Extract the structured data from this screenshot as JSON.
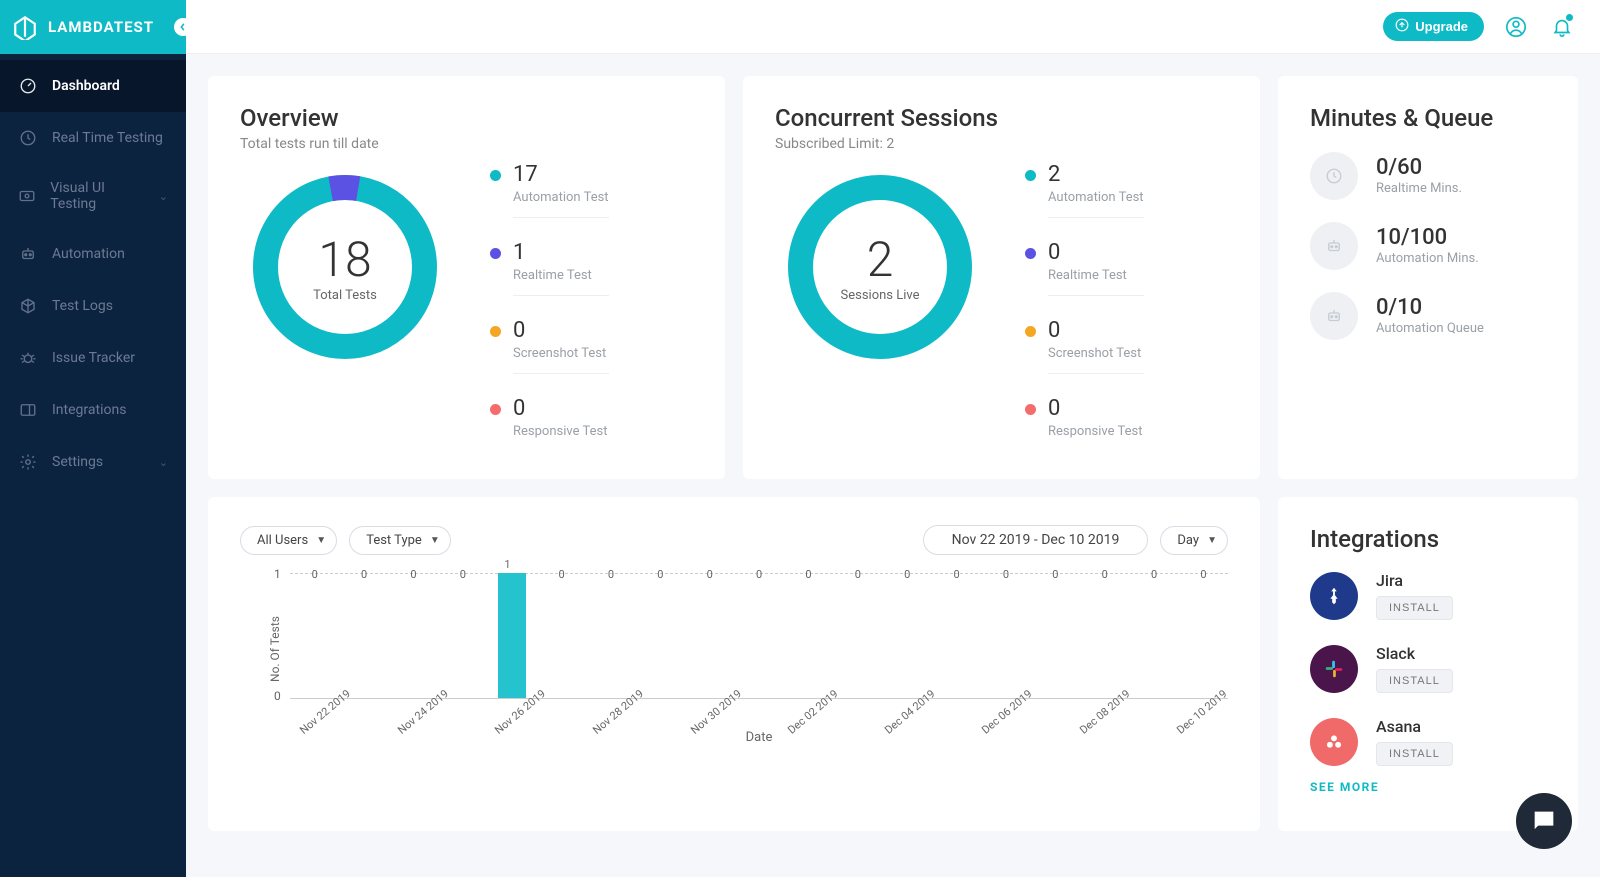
{
  "brand": {
    "name": "LAMBDATEST"
  },
  "topbar": {
    "upgrade_label": "Upgrade"
  },
  "sidebar": {
    "items": [
      {
        "label": "Dashboard",
        "active": true,
        "icon": "gauge-icon"
      },
      {
        "label": "Real Time Testing",
        "active": false,
        "icon": "clock-icon"
      },
      {
        "label": "Visual UI Testing",
        "active": false,
        "expandable": true,
        "icon": "eye-icon"
      },
      {
        "label": "Automation",
        "active": false,
        "icon": "robot-icon"
      },
      {
        "label": "Test Logs",
        "active": false,
        "icon": "cube-icon"
      },
      {
        "label": "Issue Tracker",
        "active": false,
        "icon": "bug-icon"
      },
      {
        "label": "Integrations",
        "active": false,
        "icon": "panel-icon"
      },
      {
        "label": "Settings",
        "active": false,
        "expandable": true,
        "icon": "gear-icon"
      }
    ]
  },
  "overview": {
    "title": "Overview",
    "subtitle": "Total tests run till date",
    "total": "18",
    "total_label": "Total Tests",
    "legend": [
      {
        "value": "17",
        "label": "Automation Test",
        "color": "#0ebac5"
      },
      {
        "value": "1",
        "label": "Realtime Test",
        "color": "#5b52e3"
      },
      {
        "value": "0",
        "label": "Screenshot Test",
        "color": "#f5a623"
      },
      {
        "value": "0",
        "label": "Responsive Test",
        "color": "#f56c6c"
      }
    ]
  },
  "concurrent": {
    "title": "Concurrent Sessions",
    "subtitle": "Subscribed Limit: 2",
    "total": "2",
    "total_label": "Sessions Live",
    "legend": [
      {
        "value": "2",
        "label": "Automation Test",
        "color": "#0ebac5"
      },
      {
        "value": "0",
        "label": "Realtime Test",
        "color": "#5b52e3"
      },
      {
        "value": "0",
        "label": "Screenshot Test",
        "color": "#f5a623"
      },
      {
        "value": "0",
        "label": "Responsive Test",
        "color": "#f56c6c"
      }
    ]
  },
  "minutes": {
    "title": "Minutes & Queue",
    "items": [
      {
        "value": "0/60",
        "label": "Realtime Mins.",
        "icon": "clock-icon"
      },
      {
        "value": "10/100",
        "label": "Automation Mins.",
        "icon": "robot-icon"
      },
      {
        "value": "0/10",
        "label": "Automation Queue",
        "icon": "robot-icon"
      }
    ]
  },
  "filters": {
    "users": "All Users",
    "type": "Test Type",
    "range": "Nov 22 2019 - Dec 10 2019",
    "granularity": "Day"
  },
  "chart_data": {
    "type": "bar",
    "categories": [
      "Nov 22 2019",
      "",
      "Nov 24 2019",
      "",
      "Nov 26 2019",
      "",
      "Nov 28 2019",
      "",
      "Nov 30 2019",
      "",
      "Dec 02 2019",
      "",
      "Dec 04 2019",
      "",
      "Dec 06 2019",
      "",
      "Dec 08 2019",
      "",
      "Dec 10 2019"
    ],
    "values": [
      0,
      0,
      0,
      0,
      1,
      0,
      0,
      0,
      0,
      0,
      0,
      0,
      0,
      0,
      0,
      0,
      0,
      0,
      0
    ],
    "title": "",
    "xlabel": "Date",
    "ylabel": "No. Of Tests",
    "ylim": [
      0,
      1
    ]
  },
  "integrations_panel": {
    "title": "Integrations",
    "items": [
      {
        "name": "Jira",
        "install": "INSTALL",
        "bg": "#1f3a8a"
      },
      {
        "name": "Slack",
        "install": "INSTALL",
        "bg": "#4a154b"
      },
      {
        "name": "Asana",
        "install": "INSTALL",
        "bg": "#f06a6a"
      }
    ],
    "see_more": "SEE MORE"
  }
}
